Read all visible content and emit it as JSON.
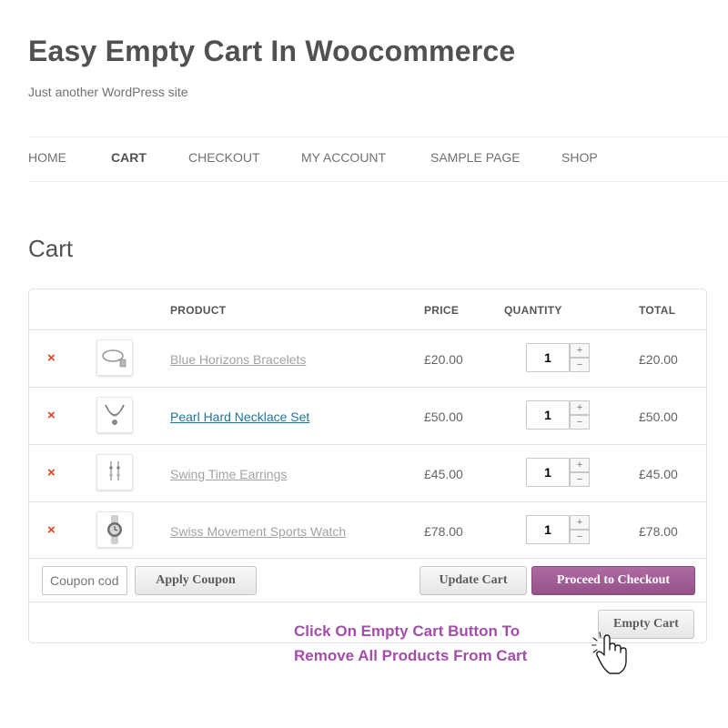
{
  "site": {
    "title": "Easy Empty Cart In Woocommerce",
    "tagline": "Just another WordPress site"
  },
  "nav": {
    "items": [
      {
        "label": "HOME"
      },
      {
        "label": "CART"
      },
      {
        "label": "CHECKOUT"
      },
      {
        "label": "MY ACCOUNT"
      },
      {
        "label": "SAMPLE PAGE"
      },
      {
        "label": "SHOP"
      }
    ],
    "active": "CART"
  },
  "page": {
    "title": "Cart"
  },
  "cart": {
    "headers": {
      "product": "PRODUCT",
      "price": "PRICE",
      "quantity": "QUANTITY",
      "total": "TOTAL"
    },
    "items": [
      {
        "remove": "×",
        "name": "Blue Horizons Bracelets",
        "price": "£20.00",
        "qty": "1",
        "total": "£20.00",
        "thumb_icon": "bracelet-icon"
      },
      {
        "remove": "×",
        "name": "Pearl Hard Necklace Set",
        "price": "£50.00",
        "qty": "1",
        "total": "£50.00",
        "thumb_icon": "necklace-icon"
      },
      {
        "remove": "×",
        "name": "Swing Time Earrings",
        "price": "£45.00",
        "qty": "1",
        "total": "£45.00",
        "thumb_icon": "earrings-icon"
      },
      {
        "remove": "×",
        "name": "Swiss Movement Sports Watch",
        "price": "£78.00",
        "qty": "1",
        "total": "£78.00",
        "thumb_icon": "watch-icon"
      }
    ],
    "qty_plus": "+",
    "qty_minus": "−",
    "coupon_placeholder": "Coupon code",
    "apply_coupon": "Apply Coupon",
    "update_cart": "Update Cart",
    "proceed": "Proceed to Checkout",
    "empty_cart": "Empty Cart"
  },
  "instruction": {
    "line1": "Click On Empty Cart  Button To",
    "line2": "Remove All Products From Cart"
  },
  "colors": {
    "remove": "#e2401c",
    "link": "#21759b",
    "primary_button": "#a46497",
    "instruction": "#a24fa9"
  }
}
